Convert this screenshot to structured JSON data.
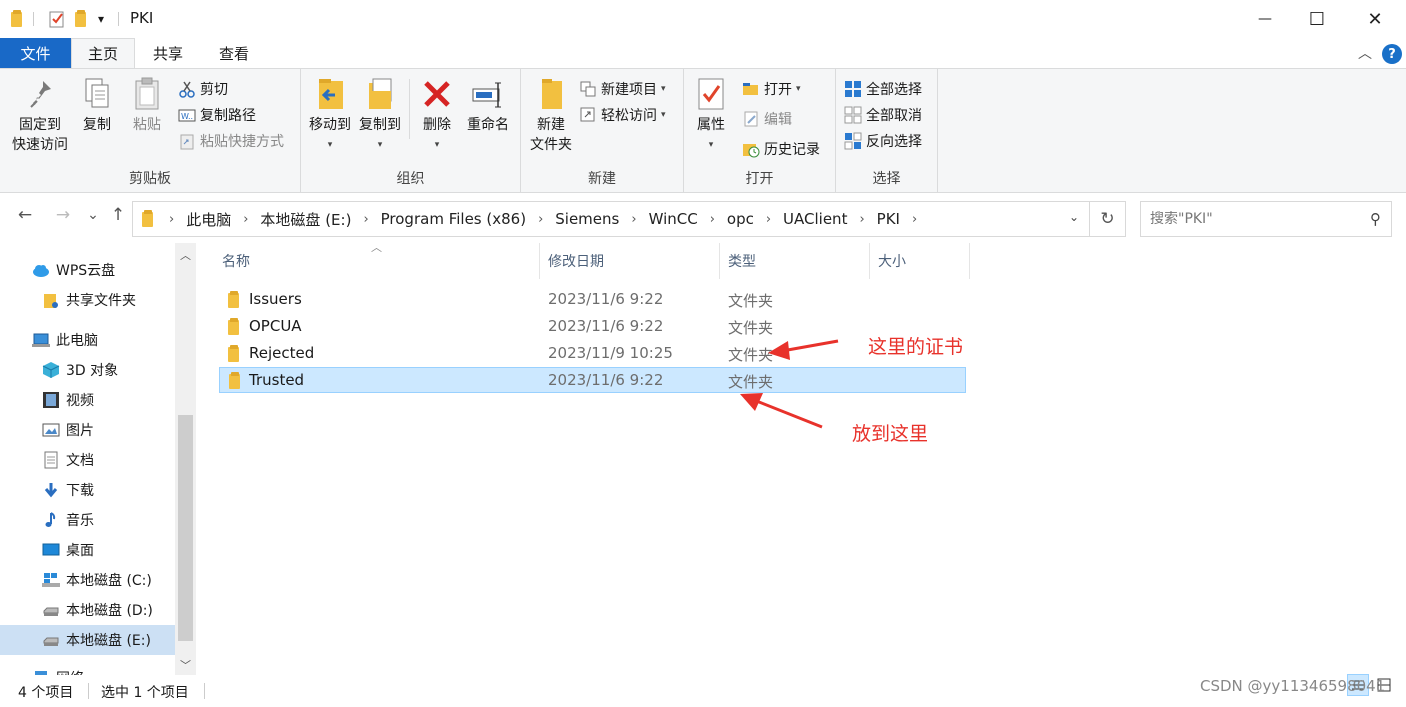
{
  "window": {
    "title": "PKI",
    "minimize_glyph": "—",
    "maximize_glyph": "☐",
    "close_glyph": "✕",
    "qa_dropdown_glyph": "▾"
  },
  "ribbon_tabs": {
    "file": "文件",
    "home": "主页",
    "share": "共享",
    "view": "查看",
    "help_glyph": "?",
    "collapse_glyph": "︿"
  },
  "clipboard": {
    "pin": [
      "固定到",
      "快速访问"
    ],
    "copy": "复制",
    "paste": "粘贴",
    "cut": "剪切",
    "copy_path": "复制路径",
    "paste_shortcut": "粘贴快捷方式",
    "label": "剪贴板"
  },
  "organize": {
    "move_to": "移动到",
    "copy_to": "复制到",
    "delete": "删除",
    "rename": "重命名",
    "label": "组织"
  },
  "new_group": {
    "new_folder": [
      "新建",
      "文件夹"
    ],
    "new_item": "新建项目",
    "easy_access": "轻松访问",
    "label": "新建"
  },
  "open_group": {
    "properties": "属性",
    "open": "打开",
    "edit": "编辑",
    "history": "历史记录",
    "label": "打开"
  },
  "select_group": {
    "select_all": "全部选择",
    "select_none": "全部取消",
    "invert": "反向选择",
    "label": "选择"
  },
  "nav": {
    "back_glyph": "←",
    "forward_glyph": "→",
    "recent_glyph": "⌄",
    "up_glyph": "↑",
    "refresh_glyph": "↻",
    "breadcrumb": [
      "此电脑",
      "本地磁盘 (E:)",
      "Program Files (x86)",
      "Siemens",
      "WinCC",
      "opc",
      "UAClient",
      "PKI"
    ],
    "search_placeholder": "搜索\"PKI\""
  },
  "sidebar": {
    "items": [
      {
        "label": "WPS云盘",
        "icon": "cloud-icon"
      },
      {
        "label": "共享文件夹",
        "icon": "shared-folder-icon"
      },
      {
        "label": "此电脑",
        "icon": "computer-icon"
      },
      {
        "label": "3D 对象",
        "icon": "3d-objects-icon"
      },
      {
        "label": "视频",
        "icon": "video-icon"
      },
      {
        "label": "图片",
        "icon": "pictures-icon"
      },
      {
        "label": "文档",
        "icon": "documents-icon"
      },
      {
        "label": "下载",
        "icon": "download-icon"
      },
      {
        "label": "音乐",
        "icon": "music-icon"
      },
      {
        "label": "桌面",
        "icon": "desktop-icon"
      },
      {
        "label": "本地磁盘 (C:)",
        "icon": "drive-icon"
      },
      {
        "label": "本地磁盘 (D:)",
        "icon": "drive-icon"
      },
      {
        "label": "本地磁盘 (E:)",
        "icon": "drive-icon"
      },
      {
        "label": "网络",
        "icon": "network-icon"
      }
    ]
  },
  "columns": {
    "name": "名称",
    "date": "修改日期",
    "type": "类型",
    "size": "大小"
  },
  "files": [
    {
      "name": "Issuers",
      "date": "2023/11/6 9:22",
      "type": "文件夹"
    },
    {
      "name": "OPCUA",
      "date": "2023/11/6 9:22",
      "type": "文件夹"
    },
    {
      "name": "Rejected",
      "date": "2023/11/9 10:25",
      "type": "文件夹"
    },
    {
      "name": "Trusted",
      "date": "2023/11/6 9:22",
      "type": "文件夹"
    }
  ],
  "annotations": {
    "cert_here": "这里的证书",
    "put_here": "放到这里",
    "color": "#e8322b"
  },
  "status": {
    "count": "4 个项目",
    "selected": "选中 1 个项目",
    "watermark": "CSDN @yy11346598041"
  },
  "colors": {
    "file_tab": "#1969c7",
    "selection": "#cce8ff",
    "folder": "#f2c040"
  }
}
